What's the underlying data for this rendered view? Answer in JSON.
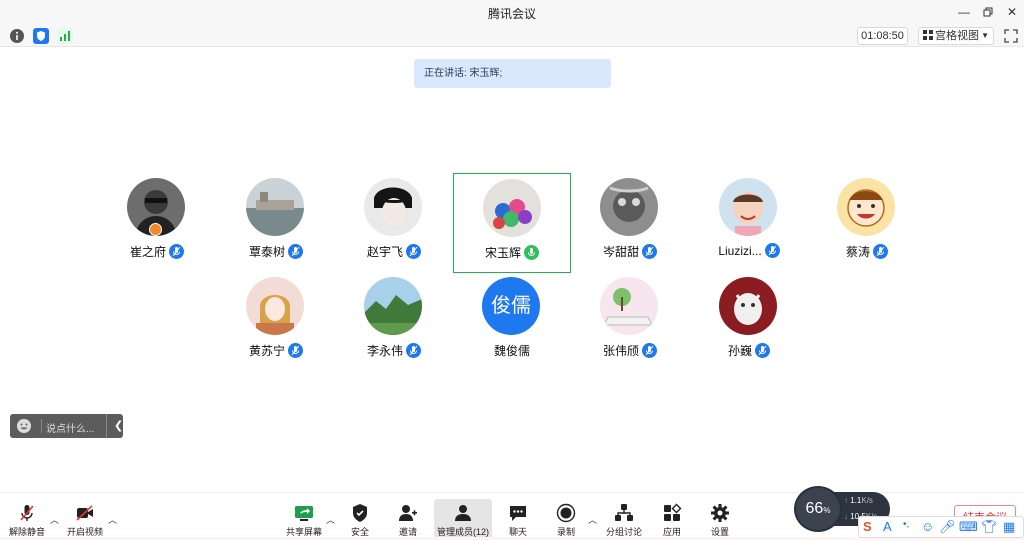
{
  "window": {
    "title": "腾讯会议"
  },
  "infobar": {
    "timer": "01:08:50",
    "view_mode": "宫格视图"
  },
  "speaking": {
    "text": "正在讲话: 宋玉辉;"
  },
  "participants": [
    {
      "name": "崔之府",
      "mic": "muted",
      "host": true
    },
    {
      "name": "覃泰树",
      "mic": "muted"
    },
    {
      "name": "赵宇飞",
      "mic": "muted"
    },
    {
      "name": "宋玉辉",
      "mic": "speaking",
      "active": true
    },
    {
      "name": "岑甜甜",
      "mic": "muted"
    },
    {
      "name": "Liuzizi...",
      "mic": "muted"
    },
    {
      "name": "蔡涛",
      "mic": "muted"
    },
    {
      "name": "黄苏宁",
      "mic": "muted"
    },
    {
      "name": "李永伟",
      "mic": "muted"
    },
    {
      "name": "魏俊儒",
      "mic": "none",
      "initials": "俊儒"
    },
    {
      "name": "张伟颀",
      "mic": "muted"
    },
    {
      "name": "孙巍",
      "mic": "muted"
    }
  ],
  "chat": {
    "placeholder": "说点什么..."
  },
  "toolbar": {
    "unmute": "解除静音",
    "start_video": "开启视频",
    "share_screen": "共享屏幕",
    "security": "安全",
    "invite": "邀请",
    "manage_members": "管理成员(12)",
    "chat": "聊天",
    "record": "录制",
    "breakout": "分组讨论",
    "apps": "应用",
    "settings": "设置",
    "end_meeting": "结束会议"
  },
  "network_widget": {
    "percent": "66",
    "percent_unit": "%",
    "upload": "1.1",
    "upload_unit": "K/s",
    "download": "10.5",
    "download_unit": "K/s"
  },
  "colors": {
    "accent": "#1e78f0",
    "speaking_green": "#23b14d",
    "banner_bg": "#d9e8fd",
    "end_red": "#e33333"
  }
}
